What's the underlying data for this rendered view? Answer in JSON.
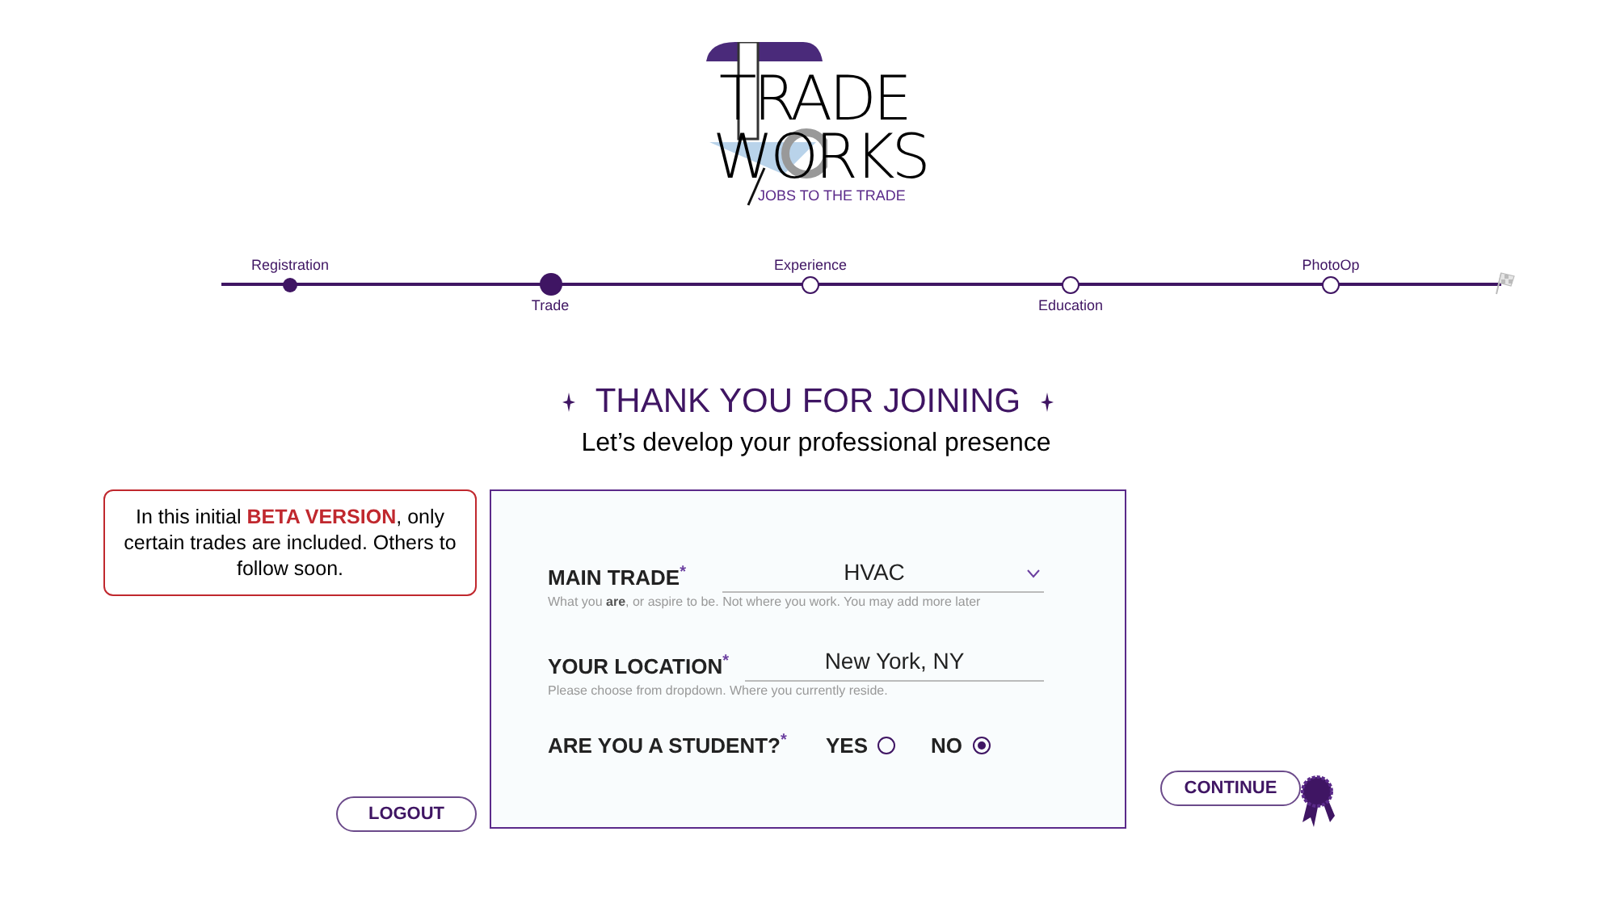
{
  "logo": {
    "word_top": "TRADE",
    "word_bottom": "WORKS",
    "tagline": "JOBS TO THE TRADE"
  },
  "steps": [
    {
      "label": "Registration",
      "completed": true,
      "selected": false
    },
    {
      "label": "Trade",
      "completed": true,
      "selected": true
    },
    {
      "label": "Experience",
      "completed": false,
      "selected": false
    },
    {
      "label": "Education",
      "completed": false,
      "selected": false
    },
    {
      "label": "PhotoOp",
      "completed": false,
      "selected": false
    }
  ],
  "heading": {
    "title": "THANK YOU FOR JOINING",
    "subtitle": "Let’s develop your professional presence"
  },
  "beta_note": "In this initial **BETA VERSION**, only certain trades are included. Others to follow soon.",
  "form": {
    "main_trade": {
      "label": "MAIN TRADE",
      "required_mark": "*",
      "value": "HVAC",
      "hint": "What you **are**, or aspire to be. Not where you work. You may add more later"
    },
    "location": {
      "label": "YOUR LOCATION",
      "required_mark": "*",
      "value": "New York, NY",
      "hint": "Please choose from dropdown. Where you currently reside."
    },
    "student": {
      "label": "ARE YOU A STUDENT?",
      "required_mark": "*",
      "options": [
        {
          "label": "YES",
          "selected": false
        },
        {
          "label": "NO",
          "selected": true
        }
      ]
    }
  },
  "buttons": {
    "logout": "LOGOUT",
    "continue": "CONTINUE"
  }
}
